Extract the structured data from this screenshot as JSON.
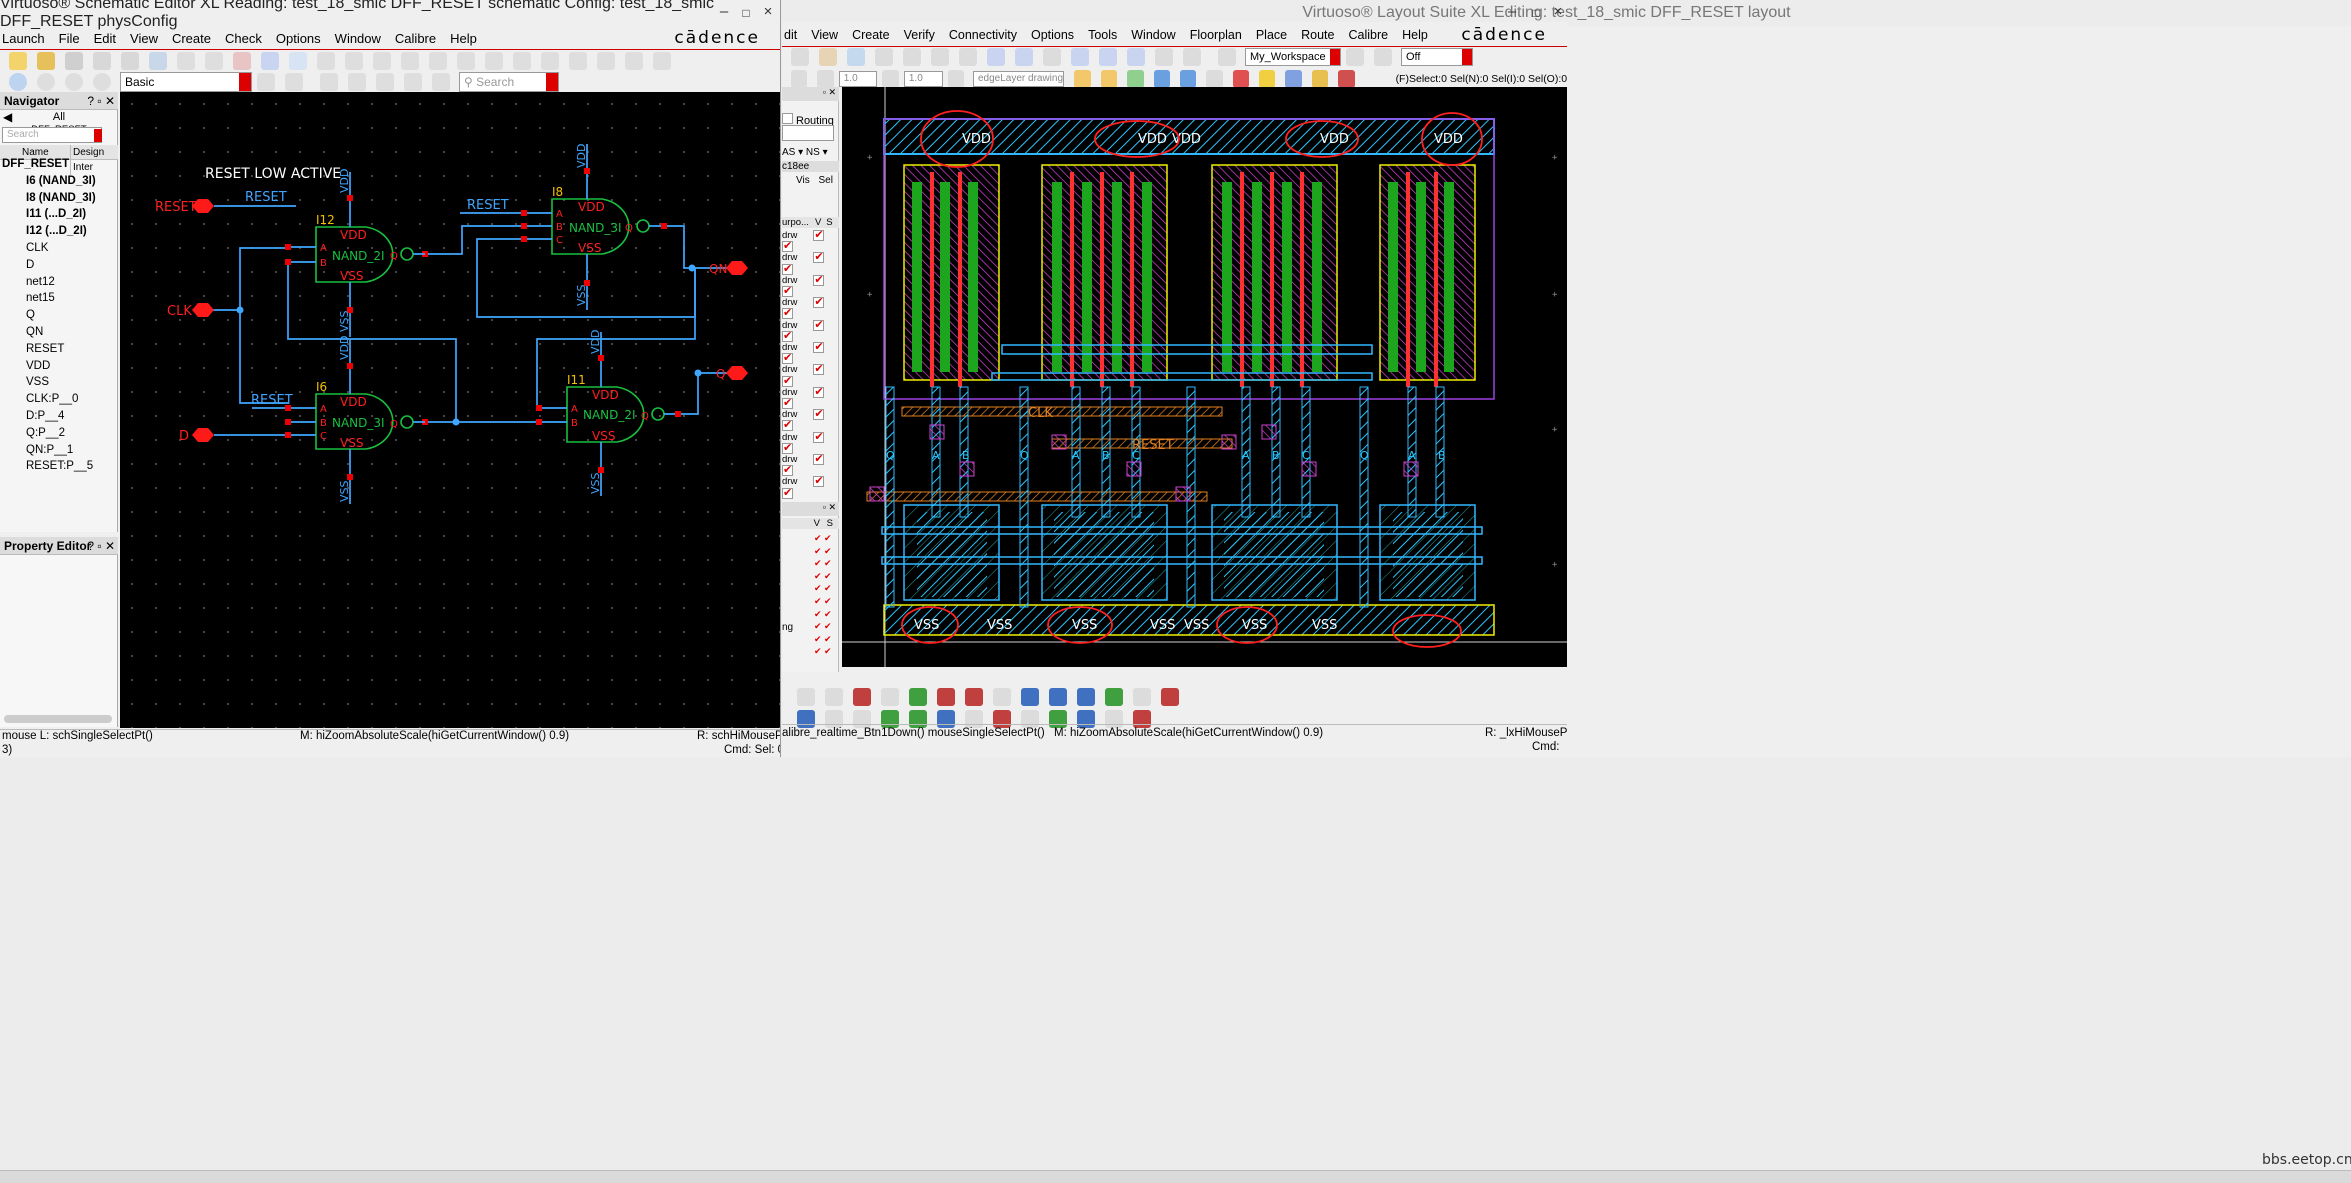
{
  "schematic": {
    "title": "Virtuoso® Schematic Editor XL Reading: test_18_smic DFF_RESET schematic  Config: test_18_smic DFF_RESET physConfig",
    "window_controls": [
      "–",
      "□",
      "×"
    ],
    "brand": "cādence",
    "menu": [
      "Launch",
      "File",
      "Edit",
      "View",
      "Create",
      "Check",
      "Options",
      "Window",
      "Calibre",
      "Help"
    ],
    "workspace": "Basic",
    "search_placeholder": "Search",
    "navigator": {
      "title": "Navigator",
      "filter": "All",
      "cell": "DFF_RESET",
      "search_placeholder": "Search",
      "col_name": "Name",
      "col_design": "Design Inter",
      "items": [
        "DFF_RESET",
        "I6 (NAND_3I)",
        "I8 (NAND_3I)",
        "I11 (...D_2I)",
        "I12 (...D_2I)",
        "CLK",
        "D",
        "net12",
        "net15",
        "Q",
        "QN",
        "RESET",
        "VDD",
        "VSS",
        "CLK:P__0",
        "D:P__4",
        "Q:P__2",
        "QN:P__1",
        "RESET:P__5"
      ]
    },
    "property_editor": {
      "title": "Property Editor"
    },
    "canvas": {
      "note": "RESET LOW ACTIVE",
      "pins": {
        "reset": "RESET",
        "clk": "CLK",
        "d": "D",
        "qn": "QN",
        "q": "Q"
      },
      "gates": [
        {
          "inst": "I12",
          "cell": "NAND_2I",
          "inputs": [
            "A",
            "B"
          ],
          "out": "Q",
          "vdd": "VDD",
          "vss": "VSS"
        },
        {
          "inst": "I8",
          "cell": "NAND_3I",
          "inputs": [
            "A",
            "B",
            "C"
          ],
          "out": "Q",
          "vdd": "VDD",
          "vss": "VSS"
        },
        {
          "inst": "I6",
          "cell": "NAND_3I",
          "inputs": [
            "A",
            "B",
            "C"
          ],
          "out": "Q",
          "vdd": "VDD",
          "vss": "VSS"
        },
        {
          "inst": "I11",
          "cell": "NAND_2I",
          "inputs": [
            "A",
            "B"
          ],
          "out": "Q",
          "vdd": "VDD",
          "vss": "VSS"
        }
      ],
      "wire_labels": {
        "reset_top": "RESET",
        "reset_i8": "RESET",
        "reset_i6": "RESET"
      }
    },
    "status": {
      "mouse_l": "mouse L: schSingleSelectPt()",
      "mouse_m": "M: hiZoomAbsoluteScale(hiGetCurrentWindow() 0.9)",
      "mouse_r": "R: schHiMousePopUp()",
      "count": "3)",
      "cmd": "Cmd:  Sel: 0"
    }
  },
  "layout": {
    "title": "Virtuoso® Layout Suite XL Editing: test_18_smic DFF_RESET layout",
    "window_controls": [
      "–",
      "□",
      "×"
    ],
    "brand": "cādence",
    "menu": [
      "dit",
      "View",
      "Create",
      "Verify",
      "Connectivity",
      "Options",
      "Tools",
      "Window",
      "Floorplan",
      "Place",
      "Route",
      "Calibre",
      "Help"
    ],
    "workspace": "My_Workspace",
    "off": "Off",
    "val1": "1.0",
    "val2": "1.0",
    "layer_drawing": "edgeLayer drawing",
    "selinfo": "(F)Select:0  Sel(N):0  Sel(I):0  Sel(O):0",
    "lsw": {
      "routing": "Routing",
      "as": "AS",
      "ns": "NS",
      "tech": "c18ee",
      "vis": "Vis",
      "sel": "Sel",
      "purpose": "urpo...",
      "v": "V",
      "s": "S",
      "rows": [
        "drw",
        "drw",
        "drw",
        "drw",
        "drw",
        "drw",
        "drw",
        "drw",
        "drw",
        "drw",
        "drw",
        "drw"
      ],
      "lower_label": "ng"
    },
    "labels": {
      "vdd": [
        "VDD",
        "VDD",
        "VDD",
        "VDD",
        "VDD",
        "VDD"
      ],
      "vss": [
        "VSS",
        "VSS",
        "VSS",
        "VSS",
        "VSS",
        "VSS",
        "VSS"
      ],
      "clk": "CLK",
      "reset": "RESET",
      "pins": [
        "Q",
        "A",
        "B",
        "Q",
        "A",
        "B",
        "C",
        "A",
        "B",
        "C",
        "Q",
        "A",
        "B"
      ]
    },
    "status": {
      "mouse_l": "alibre_realtime_Btn1Down() mouseSingleSelectPt()",
      "mouse_m": "M: hiZoomAbsoluteScale(hiGetCurrentWindow() 0.9)",
      "mouse_r": "R: _lxHiMousePopUp()",
      "cmd": "Cmd:"
    }
  },
  "watermark": "bbs.eetop.cn"
}
